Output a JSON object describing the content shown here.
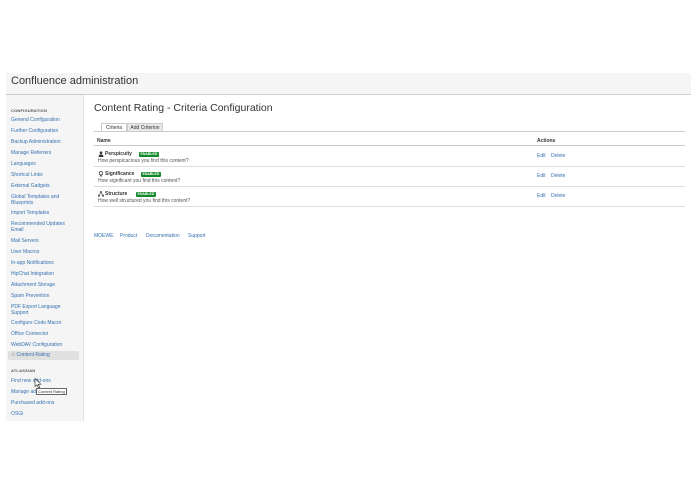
{
  "header": {
    "title": "Confluence administration"
  },
  "sidebar": {
    "configuration_heading": "CONFIGURATION",
    "items": [
      {
        "label": "General Configuration"
      },
      {
        "label": "Further Configuration"
      },
      {
        "label": "Backup Administration"
      },
      {
        "label": "Manage Referrers"
      },
      {
        "label": "Languages"
      },
      {
        "label": "Shortcut Links"
      },
      {
        "label": "External Gadgets"
      },
      {
        "label": "Global Templates and Blueprints"
      },
      {
        "label": "Import Templates"
      },
      {
        "label": "Recommended Updates Email"
      },
      {
        "label": "Mail Servers"
      },
      {
        "label": "User Macros"
      },
      {
        "label": "In-app Notifications"
      },
      {
        "label": "HipChat Integration"
      },
      {
        "label": "Attachment Storage"
      },
      {
        "label": "Spam Prevention"
      },
      {
        "label": "PDF Export Language Support"
      },
      {
        "label": "Configure Code Macro"
      },
      {
        "label": "Office Connector"
      },
      {
        "label": "WebDAV Configuration"
      },
      {
        "label": "Content Rating",
        "icon": "star-icon",
        "selected": true
      }
    ],
    "atlassian_heading": "ATLASSIAN",
    "marketplace_items": [
      {
        "label": "Find new add-ons"
      },
      {
        "label": "Manage add-ons"
      },
      {
        "label": "Purchased add-ons"
      },
      {
        "label": "OSGi"
      }
    ],
    "tooltip": "Content Rating"
  },
  "main": {
    "title": "Content Rating - Criteria Configuration",
    "tabs": [
      {
        "label": "Criteria",
        "active": true
      },
      {
        "label": "Add Criterion",
        "active": false
      }
    ],
    "table": {
      "headers": {
        "name": "Name",
        "actions": "Actions"
      },
      "rows": [
        {
          "icon": "user-icon",
          "name": "Perspicuity",
          "status": "ENABLED",
          "description": "How perspicacious you find this content?",
          "edit": "Edit",
          "delete": "Delete"
        },
        {
          "icon": "lightbulb-icon",
          "name": "Significance",
          "status": "ENABLED",
          "description": "How significant you find this content?",
          "edit": "Edit",
          "delete": "Delete"
        },
        {
          "icon": "sitemap-icon",
          "name": "Structure",
          "status": "ENABLED",
          "description": "How well structured you find this content?",
          "edit": "Edit",
          "delete": "Delete"
        }
      ]
    },
    "footer_links": [
      {
        "label": "MOEWE"
      },
      {
        "label": "Product"
      },
      {
        "label": "Documentation"
      },
      {
        "label": "Support"
      }
    ]
  },
  "colors": {
    "link": "#3572b0",
    "enabled_lozenge": "#14892c",
    "sidebar_bg": "#f5f5f5",
    "selected_bg": "#e0e0e0"
  }
}
